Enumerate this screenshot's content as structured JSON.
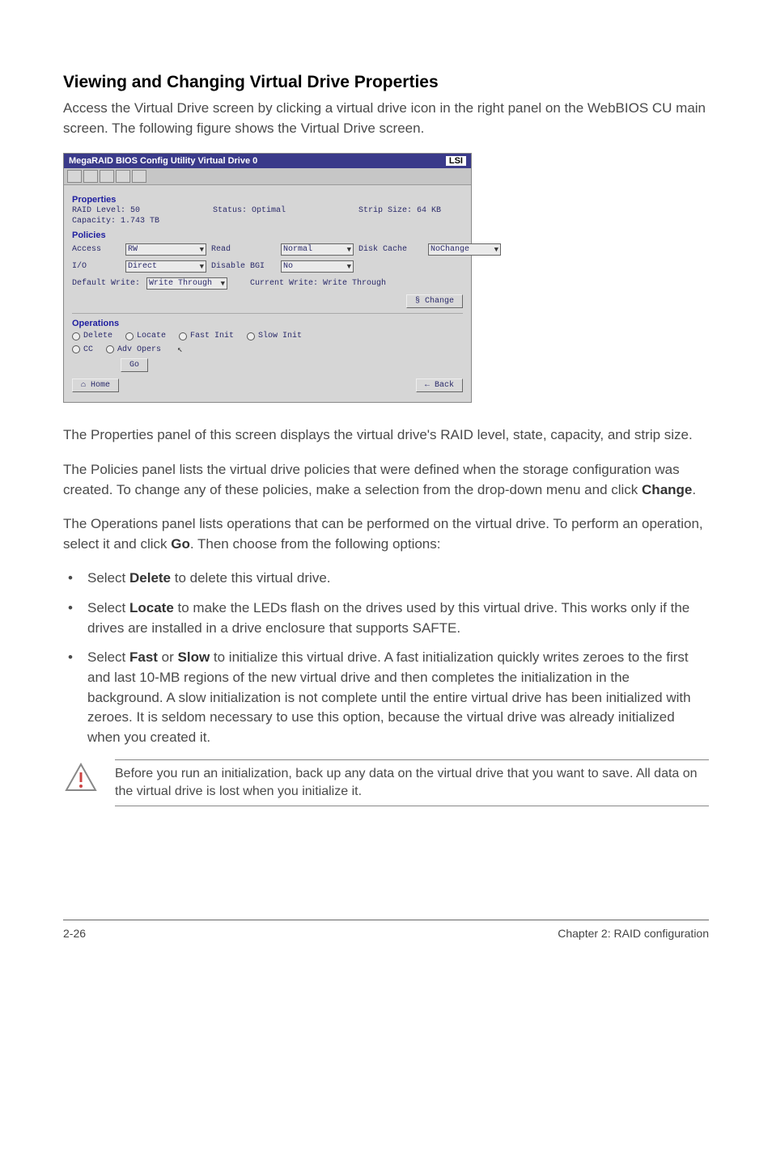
{
  "headings": {
    "main": "Viewing and Changing Virtual Drive Properties"
  },
  "paragraphs": {
    "intro": "Access the Virtual Drive screen by clicking a virtual drive icon in the right panel on the WebBIOS CU main screen. The following figure shows the Virtual Drive screen.",
    "props": "The Properties panel of this screen displays the virtual drive's RAID level, state, capacity, and strip size.",
    "policies_a": "The Policies panel lists the virtual drive policies that were defined when the storage configuration was created. To change any of these policies, make a selection from the drop-down menu and click ",
    "policies_b": "Change",
    "policies_c": ".",
    "ops_a": "The Operations panel lists operations that can be performed on the virtual drive. To perform an operation, select it and click ",
    "ops_b": "Go",
    "ops_c": ". Then choose from the following options:"
  },
  "bullets": {
    "b1_a": "Select ",
    "b1_b": "Delete",
    "b1_c": " to delete this virtual drive.",
    "b2_a": "Select ",
    "b2_b": "Locate",
    "b2_c": " to make the LEDs flash on the drives used by this virtual drive. This works only if the drives are installed in a drive enclosure that supports SAFTE.",
    "b3_a": "Select ",
    "b3_b": "Fast",
    "b3_c": " or ",
    "b3_d": "Slow",
    "b3_e": " to initialize this virtual drive. A fast initialization quickly writes zeroes to the first and last 10-MB regions of the new virtual drive and then completes the initialization in the background. A slow initialization is not complete until the entire virtual drive has been initialized with zeroes. It is seldom necessary to use this option, because the virtual drive was already initialized when you created it."
  },
  "callout": {
    "text": "Before you run an initialization, back up any data on the virtual drive that you want to save. All data on the virtual drive is lost when you initialize it."
  },
  "footer": {
    "left": "2-26",
    "right": "Chapter 2: RAID configuration"
  },
  "screenshot": {
    "title": "MegaRAID BIOS Config Utility Virtual Drive 0",
    "brand": "LSI",
    "panels": {
      "properties": "Properties",
      "policies": "Policies",
      "operations": "Operations"
    },
    "properties": {
      "raid_level": "RAID Level: 50",
      "status": "Status: Optimal",
      "strip": "Strip Size: 64 KB",
      "capacity": "Capacity: 1.743 TB"
    },
    "policies": {
      "access_label": "Access",
      "access_value": "RW",
      "read_label": "Read",
      "read_value": "Normal",
      "disk_cache_label": "Disk Cache",
      "disk_cache_value": "NoChange",
      "io_label": "I/O",
      "io_value": "Direct",
      "disable_bgi_label": "Disable BGI",
      "disable_bgi_value": "No",
      "default_write_label": "Default Write:",
      "default_write_value": "Write Through",
      "current_write": "Current Write: Write Through",
      "change_btn": "Change"
    },
    "operations": {
      "delete": "Delete",
      "locate": "Locate",
      "fast_init": "Fast Init",
      "slow_init": "Slow Init",
      "cc": "CC",
      "adv_opers": "Adv Opers",
      "go_btn": "Go"
    },
    "nav": {
      "home": "Home",
      "back": "Back"
    }
  }
}
